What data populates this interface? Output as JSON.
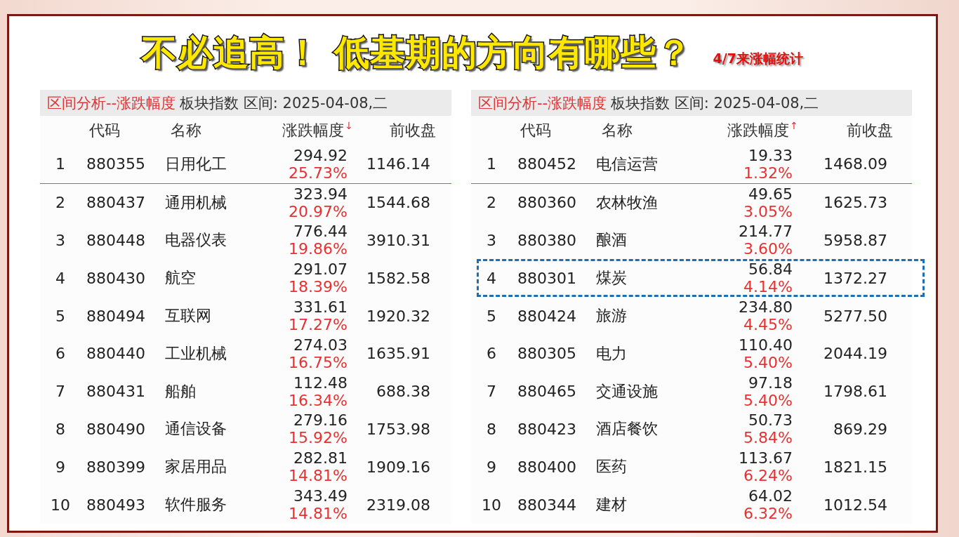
{
  "title": "不必追高！ 低基期的方向有哪些？",
  "subtitle": "4/7来涨幅统计",
  "tables": [
    {
      "header_title": "区间分析--涨跌幅度",
      "header_info": "板块指数 区间: 2025-04-08,二",
      "columns": [
        {
          "label": "代码"
        },
        {
          "label": "名称"
        },
        {
          "label": "涨跌幅度",
          "sort_arrow": "↓"
        },
        {
          "label": "前收盘"
        }
      ],
      "rows": [
        {
          "rank": "1",
          "code": "880355",
          "name": "日用化工",
          "change": "294.92",
          "percent": "25.73%",
          "prev_close": "1146.14",
          "highlighted": false
        },
        {
          "rank": "2",
          "code": "880437",
          "name": "通用机械",
          "change": "323.94",
          "percent": "20.97%",
          "prev_close": "1544.68",
          "highlighted": false
        },
        {
          "rank": "3",
          "code": "880448",
          "name": "电器仪表",
          "change": "776.44",
          "percent": "19.86%",
          "prev_close": "3910.31",
          "highlighted": false
        },
        {
          "rank": "4",
          "code": "880430",
          "name": "航空",
          "change": "291.07",
          "percent": "18.39%",
          "prev_close": "1582.58",
          "highlighted": false
        },
        {
          "rank": "5",
          "code": "880494",
          "name": "互联网",
          "change": "331.61",
          "percent": "17.27%",
          "prev_close": "1920.32",
          "highlighted": false
        },
        {
          "rank": "6",
          "code": "880440",
          "name": "工业机械",
          "change": "274.03",
          "percent": "16.75%",
          "prev_close": "1635.91",
          "highlighted": false
        },
        {
          "rank": "7",
          "code": "880431",
          "name": "船舶",
          "change": "112.48",
          "percent": "16.34%",
          "prev_close": "688.38",
          "highlighted": false
        },
        {
          "rank": "8",
          "code": "880490",
          "name": "通信设备",
          "change": "279.16",
          "percent": "15.92%",
          "prev_close": "1753.98",
          "highlighted": false
        },
        {
          "rank": "9",
          "code": "880399",
          "name": "家居用品",
          "change": "282.81",
          "percent": "14.81%",
          "prev_close": "1909.16",
          "highlighted": false
        },
        {
          "rank": "10",
          "code": "880493",
          "name": "软件服务",
          "change": "343.49",
          "percent": "14.81%",
          "prev_close": "2319.08",
          "highlighted": false
        }
      ]
    },
    {
      "header_title": "区间分析--涨跌幅度",
      "header_info": "板块指数 区间: 2025-04-08,二",
      "columns": [
        {
          "label": "代码"
        },
        {
          "label": "名称"
        },
        {
          "label": "涨跌幅度",
          "sort_arrow": "↑"
        },
        {
          "label": "前收盘"
        }
      ],
      "rows": [
        {
          "rank": "1",
          "code": "880452",
          "name": "电信运营",
          "change": "19.33",
          "percent": "1.32%",
          "prev_close": "1468.09",
          "highlighted": false
        },
        {
          "rank": "2",
          "code": "880360",
          "name": "农林牧渔",
          "change": "49.65",
          "percent": "3.05%",
          "prev_close": "1625.73",
          "highlighted": false
        },
        {
          "rank": "3",
          "code": "880380",
          "name": "酿酒",
          "change": "214.77",
          "percent": "3.60%",
          "prev_close": "5958.87",
          "highlighted": false
        },
        {
          "rank": "4",
          "code": "880301",
          "name": "煤炭",
          "change": "56.84",
          "percent": "4.14%",
          "prev_close": "1372.27",
          "highlighted": true
        },
        {
          "rank": "5",
          "code": "880424",
          "name": "旅游",
          "change": "234.80",
          "percent": "4.45%",
          "prev_close": "5277.50",
          "highlighted": false
        },
        {
          "rank": "6",
          "code": "880305",
          "name": "电力",
          "change": "110.40",
          "percent": "5.40%",
          "prev_close": "2044.19",
          "highlighted": false
        },
        {
          "rank": "7",
          "code": "880465",
          "name": "交通设施",
          "change": "97.18",
          "percent": "5.40%",
          "prev_close": "1798.61",
          "highlighted": false
        },
        {
          "rank": "8",
          "code": "880423",
          "name": "酒店餐饮",
          "change": "50.73",
          "percent": "5.84%",
          "prev_close": "869.29",
          "highlighted": false
        },
        {
          "rank": "9",
          "code": "880400",
          "name": "医药",
          "change": "113.67",
          "percent": "6.24%",
          "prev_close": "1821.15",
          "highlighted": false
        },
        {
          "rank": "10",
          "code": "880344",
          "name": "建材",
          "change": "64.02",
          "percent": "6.32%",
          "prev_close": "1012.54",
          "highlighted": false
        }
      ]
    }
  ]
}
